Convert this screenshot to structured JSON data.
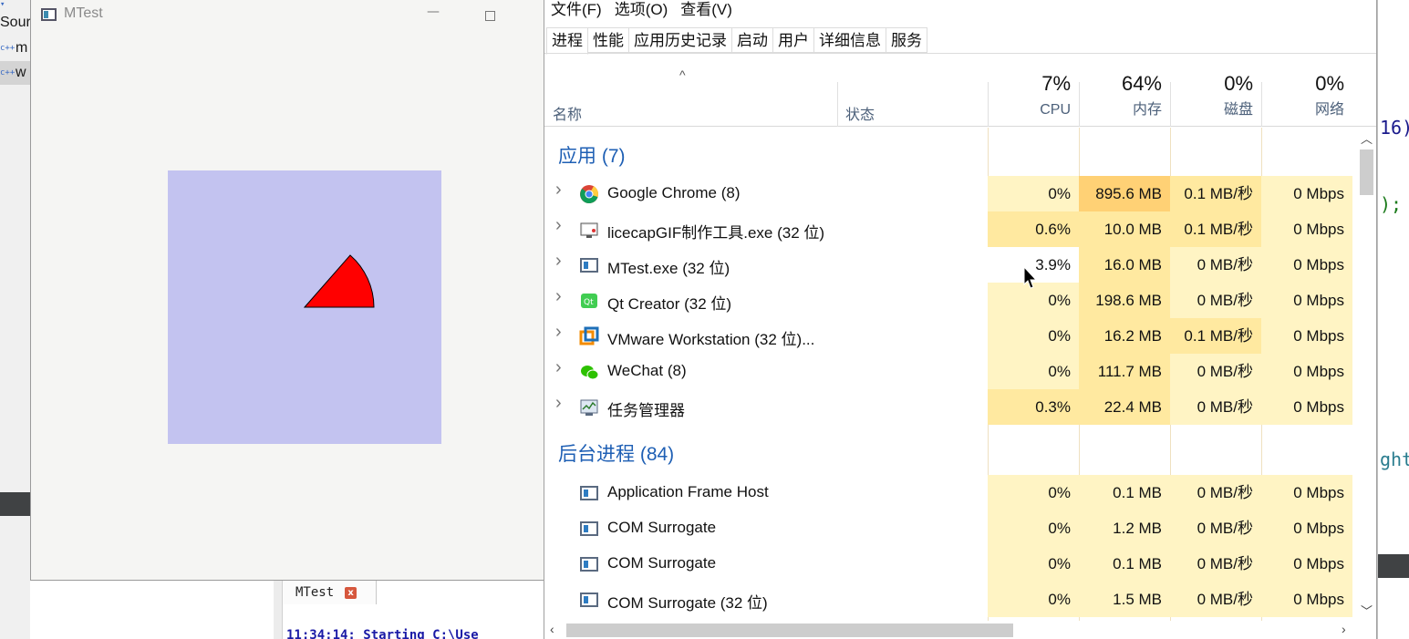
{
  "background_ide": {
    "left_panel": [
      {
        "label": "Sour"
      },
      {
        "label": "m"
      },
      {
        "label": "w"
      }
    ],
    "output_tab": {
      "label": "MTest",
      "close": "x"
    },
    "output_log": "11:34:14: Starting C:\\Use",
    "right_code": [
      {
        "text": "16)",
        "color": "#1a1a8c"
      },
      {
        "text": ");",
        "color": "#1a7a1a"
      },
      {
        "text": "ght",
        "color": "#2a7d8f"
      }
    ]
  },
  "mtest_window": {
    "title": "MTest",
    "minimize": "—",
    "canvas_color": "#c3c3f0",
    "sector_color": "#ff0000"
  },
  "task_manager": {
    "menu": [
      "文件(F)",
      "选项(O)",
      "查看(V)"
    ],
    "tabs": [
      "进程",
      "性能",
      "应用历史记录",
      "启动",
      "用户",
      "详细信息",
      "服务"
    ],
    "active_tab": "进程",
    "header": {
      "sort_caret": "^",
      "name": "名称",
      "status": "状态",
      "columns": [
        {
          "key": "cpu",
          "pct": "7%",
          "label": "CPU"
        },
        {
          "key": "mem",
          "pct": "64%",
          "label": "内存"
        },
        {
          "key": "disk",
          "pct": "0%",
          "label": "磁盘"
        },
        {
          "key": "net",
          "pct": "0%",
          "label": "网络"
        }
      ]
    },
    "groups": [
      {
        "title": "应用 (7)",
        "rows": [
          {
            "icon": "chrome-icon",
            "name": "Google Chrome (8)",
            "cpu": "0%",
            "mem": "895.6 MB",
            "disk": "0.1 MB/秒",
            "net": "0 Mbps",
            "expandable": true
          },
          {
            "icon": "licecap-icon",
            "name": "licecapGIF制作工具.exe (32 位)",
            "cpu": "0.6%",
            "mem": "10.0 MB",
            "disk": "0.1 MB/秒",
            "net": "0 Mbps",
            "expandable": true
          },
          {
            "icon": "app-window-icon",
            "name": "MTest.exe (32 位)",
            "cpu": "3.9%",
            "mem": "16.0 MB",
            "disk": "0 MB/秒",
            "net": "0 Mbps",
            "expandable": true
          },
          {
            "icon": "qt-creator-icon",
            "name": "Qt Creator (32 位)",
            "cpu": "0%",
            "mem": "198.6 MB",
            "disk": "0 MB/秒",
            "net": "0 Mbps",
            "expandable": true
          },
          {
            "icon": "vmware-icon",
            "name": "VMware Workstation (32 位)...",
            "cpu": "0%",
            "mem": "16.2 MB",
            "disk": "0.1 MB/秒",
            "net": "0 Mbps",
            "expandable": true
          },
          {
            "icon": "wechat-icon",
            "name": "WeChat (8)",
            "cpu": "0%",
            "mem": "111.7 MB",
            "disk": "0 MB/秒",
            "net": "0 Mbps",
            "expandable": true
          },
          {
            "icon": "task-manager-icon",
            "name": "任务管理器",
            "cpu": "0.3%",
            "mem": "22.4 MB",
            "disk": "0 MB/秒",
            "net": "0 Mbps",
            "expandable": true
          }
        ]
      },
      {
        "title": "后台进程 (84)",
        "rows": [
          {
            "icon": "app-window-icon",
            "name": "Application Frame Host",
            "cpu": "0%",
            "mem": "0.1 MB",
            "disk": "0 MB/秒",
            "net": "0 Mbps",
            "expandable": false
          },
          {
            "icon": "app-window-icon",
            "name": "COM Surrogate",
            "cpu": "0%",
            "mem": "1.2 MB",
            "disk": "0 MB/秒",
            "net": "0 Mbps",
            "expandable": false
          },
          {
            "icon": "app-window-icon",
            "name": "COM Surrogate",
            "cpu": "0%",
            "mem": "0.1 MB",
            "disk": "0 MB/秒",
            "net": "0 Mbps",
            "expandable": false
          },
          {
            "icon": "app-window-icon",
            "name": "COM Surrogate (32 位)",
            "cpu": "0%",
            "mem": "1.5 MB",
            "disk": "0 MB/秒",
            "net": "0 Mbps",
            "expandable": false
          }
        ]
      }
    ],
    "heat_colors": {
      "light": "#fff4c4",
      "mid": "#ffe9a0",
      "strong": "#ffd175",
      "none": "#ffffff"
    }
  }
}
